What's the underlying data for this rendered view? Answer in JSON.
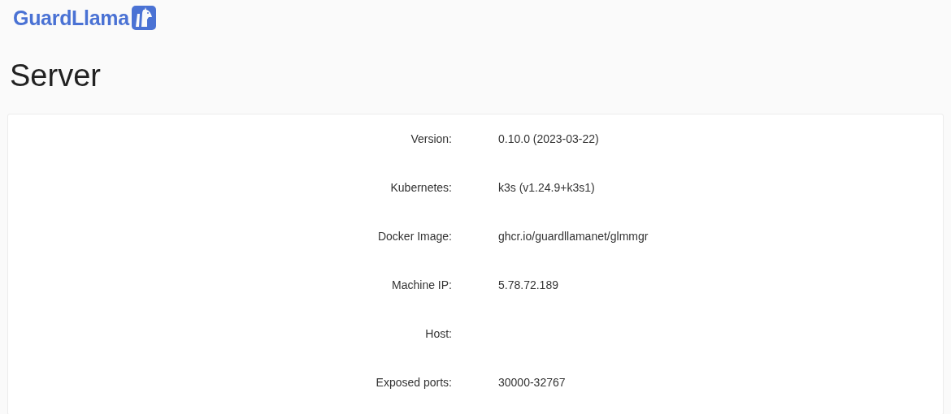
{
  "header": {
    "logo_text": "GuardLlama"
  },
  "title": "Server",
  "details": [
    {
      "label": "Version:",
      "value": "0.10.0 (2023-03-22)"
    },
    {
      "label": "Kubernetes:",
      "value": "k3s (v1.24.9+k3s1)"
    },
    {
      "label": "Docker Image:",
      "value": "ghcr.io/guardllamanet/glmmgr"
    },
    {
      "label": "Machine IP:",
      "value": "5.78.72.189"
    },
    {
      "label": "Host:"
    },
    {
      "label": "Exposed ports:",
      "value": "30000-32767"
    }
  ]
}
